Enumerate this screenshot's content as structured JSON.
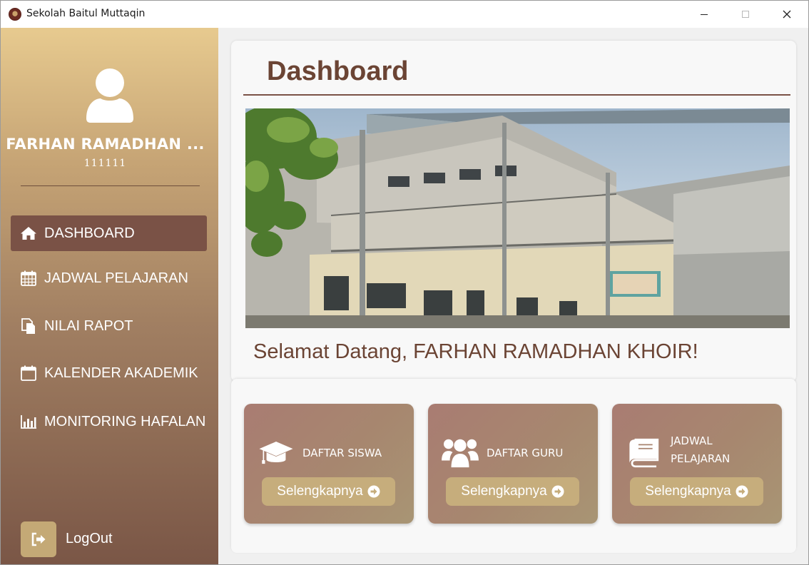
{
  "window": {
    "title": "Sekolah Baitul Muttaqin"
  },
  "sidebar": {
    "user_name": "FARHAN RAMADHAN ...",
    "user_id": "111111",
    "items": [
      {
        "label": "DASHBOARD",
        "icon": "home-icon",
        "active": true
      },
      {
        "label": "JADWAL PELAJARAN",
        "icon": "calendar-grid-icon",
        "active": false
      },
      {
        "label": "NILAI RAPOT",
        "icon": "document-copy-icon",
        "active": false
      },
      {
        "label": "KALENDER AKADEMIK",
        "icon": "calendar-icon",
        "active": false
      },
      {
        "label": "MONITORING HAFALAN",
        "icon": "bar-chart-icon",
        "active": false
      }
    ],
    "logout_label": "LogOut"
  },
  "main": {
    "title": "Dashboard",
    "welcome": "Selamat Datang, FARHAN RAMADHAN KHOIR!",
    "tiles": [
      {
        "label": "DAFTAR SISWA",
        "icon": "graduation-cap-icon",
        "button": "Selengkapnya"
      },
      {
        "label": "DAFTAR GURU",
        "icon": "users-icon",
        "button": "Selengkapnya"
      },
      {
        "label": "JADWAL PELAJARAN",
        "icon": "book-icon",
        "button": "Selengkapnya"
      }
    ]
  },
  "colors": {
    "accent_brown": "#7a5246",
    "title_brown": "#6b4434",
    "sidebar_top": "#e7ca8f",
    "sidebar_bottom": "#7a5646",
    "button_gold": "#c6ad7c"
  }
}
